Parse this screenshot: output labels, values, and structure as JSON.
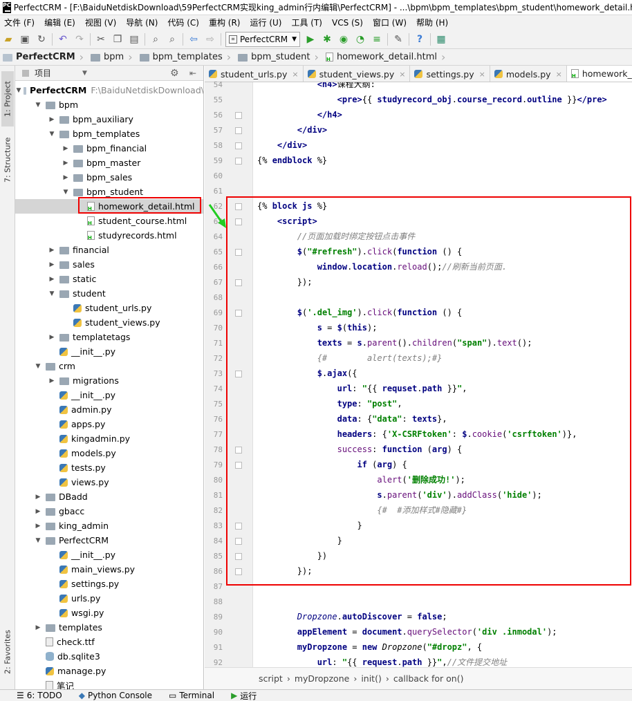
{
  "window": {
    "title": "PerfectCRM - [F:\\BaiduNetdiskDownload\\59PerfectCRM实现king_admin行内编辑\\PerfectCRM] - ...\\bpm\\bpm_templates\\bpm_student\\homework_detail.html"
  },
  "menu": [
    "文件 (F)",
    "编辑 (E)",
    "视图 (V)",
    "导航 (N)",
    "代码 (C)",
    "重构 (R)",
    "运行 (U)",
    "工具 (T)",
    "VCS (S)",
    "窗口 (W)",
    "帮助 (H)"
  ],
  "toolbar": {
    "run_config": "PerfectCRM"
  },
  "breadcrumbs": [
    "PerfectCRM",
    "bpm",
    "bpm_templates",
    "bpm_student",
    "homework_detail.html"
  ],
  "left_tabs": {
    "project": "1: Project",
    "structure": "7: Structure",
    "favorites": "2: Favorites"
  },
  "project_panel": {
    "title": "项目",
    "root_path": "F:\\BaiduNetdiskDownload\\"
  },
  "tree": [
    {
      "label": "PerfectCRM",
      "indent": 0,
      "arrow": "▼",
      "type": "folder"
    },
    {
      "label": "bpm",
      "indent": 1,
      "arrow": "▼",
      "type": "folder"
    },
    {
      "label": "bpm_auxiliary",
      "indent": 2,
      "arrow": "▶",
      "type": "folder"
    },
    {
      "label": "bpm_templates",
      "indent": 2,
      "arrow": "▼",
      "type": "folder"
    },
    {
      "label": "bpm_financial",
      "indent": 3,
      "arrow": "▶",
      "type": "folder"
    },
    {
      "label": "bpm_master",
      "indent": 3,
      "arrow": "▶",
      "type": "folder"
    },
    {
      "label": "bpm_sales",
      "indent": 3,
      "arrow": "▶",
      "type": "folder"
    },
    {
      "label": "bpm_student",
      "indent": 3,
      "arrow": "▼",
      "type": "folder"
    },
    {
      "label": "homework_detail.html",
      "indent": 4,
      "arrow": "",
      "type": "html",
      "selected": true
    },
    {
      "label": "student_course.html",
      "indent": 4,
      "arrow": "",
      "type": "html"
    },
    {
      "label": "studyrecords.html",
      "indent": 4,
      "arrow": "",
      "type": "html"
    },
    {
      "label": "financial",
      "indent": 2,
      "arrow": "▶",
      "type": "folder"
    },
    {
      "label": "sales",
      "indent": 2,
      "arrow": "▶",
      "type": "folder"
    },
    {
      "label": "static",
      "indent": 2,
      "arrow": "▶",
      "type": "folder"
    },
    {
      "label": "student",
      "indent": 2,
      "arrow": "▼",
      "type": "folder"
    },
    {
      "label": "student_urls.py",
      "indent": 3,
      "arrow": "",
      "type": "py"
    },
    {
      "label": "student_views.py",
      "indent": 3,
      "arrow": "",
      "type": "py"
    },
    {
      "label": "templatetags",
      "indent": 2,
      "arrow": "▶",
      "type": "folder"
    },
    {
      "label": "__init__.py",
      "indent": 2,
      "arrow": "",
      "type": "py"
    },
    {
      "label": "crm",
      "indent": 1,
      "arrow": "▼",
      "type": "folder"
    },
    {
      "label": "migrations",
      "indent": 2,
      "arrow": "▶",
      "type": "folder"
    },
    {
      "label": "__init__.py",
      "indent": 2,
      "arrow": "",
      "type": "py"
    },
    {
      "label": "admin.py",
      "indent": 2,
      "arrow": "",
      "type": "py"
    },
    {
      "label": "apps.py",
      "indent": 2,
      "arrow": "",
      "type": "py"
    },
    {
      "label": "kingadmin.py",
      "indent": 2,
      "arrow": "",
      "type": "py"
    },
    {
      "label": "models.py",
      "indent": 2,
      "arrow": "",
      "type": "py"
    },
    {
      "label": "tests.py",
      "indent": 2,
      "arrow": "",
      "type": "py"
    },
    {
      "label": "views.py",
      "indent": 2,
      "arrow": "",
      "type": "py"
    },
    {
      "label": "DBadd",
      "indent": 1,
      "arrow": "▶",
      "type": "folder"
    },
    {
      "label": "gbacc",
      "indent": 1,
      "arrow": "▶",
      "type": "folder"
    },
    {
      "label": "king_admin",
      "indent": 1,
      "arrow": "▶",
      "type": "folder"
    },
    {
      "label": "PerfectCRM",
      "indent": 1,
      "arrow": "▼",
      "type": "folder"
    },
    {
      "label": "__init__.py",
      "indent": 2,
      "arrow": "",
      "type": "py"
    },
    {
      "label": "main_views.py",
      "indent": 2,
      "arrow": "",
      "type": "py"
    },
    {
      "label": "settings.py",
      "indent": 2,
      "arrow": "",
      "type": "py"
    },
    {
      "label": "urls.py",
      "indent": 2,
      "arrow": "",
      "type": "py"
    },
    {
      "label": "wsgi.py",
      "indent": 2,
      "arrow": "",
      "type": "py"
    },
    {
      "label": "templates",
      "indent": 1,
      "arrow": "▶",
      "type": "folder"
    },
    {
      "label": "check.ttf",
      "indent": 1,
      "arrow": "",
      "type": "ttf"
    },
    {
      "label": "db.sqlite3",
      "indent": 1,
      "arrow": "",
      "type": "db"
    },
    {
      "label": "manage.py",
      "indent": 1,
      "arrow": "",
      "type": "py"
    },
    {
      "label": "笔记",
      "indent": 1,
      "arrow": "",
      "type": "ttf"
    }
  ],
  "editor_tabs": [
    {
      "label": "student_urls.py",
      "active": false
    },
    {
      "label": "student_views.py",
      "active": false
    },
    {
      "label": "settings.py",
      "active": false
    },
    {
      "label": "models.py",
      "active": false
    },
    {
      "label": "homework_detail.html",
      "active": true
    }
  ],
  "code_lines": [
    {
      "n": "54",
      "html": "            <span class=\"tag\">&lt;h4&gt;</span>课程大纲:"
    },
    {
      "n": "55",
      "html": "                <span class=\"tag\">&lt;pre&gt;</span>{{ <span class=\"var\">studyrecord_obj</span>.<span class=\"var\">course_record</span>.<span class=\"var\">outline</span> }}<span class=\"tag\">&lt;/pre&gt;</span>"
    },
    {
      "n": "56",
      "html": "            <span class=\"tag\">&lt;/h4&gt;</span>"
    },
    {
      "n": "57",
      "html": "        <span class=\"tag\">&lt;/div&gt;</span>"
    },
    {
      "n": "58",
      "html": "    <span class=\"tag\">&lt;/div&gt;</span>"
    },
    {
      "n": "59",
      "html": "{% <span class=\"kw\">endblock</span> %}"
    },
    {
      "n": "60",
      "html": ""
    },
    {
      "n": "61",
      "html": ""
    },
    {
      "n": "62",
      "html": "{% <span class=\"kw\">block</span> <span class=\"kw\">js</span> %}"
    },
    {
      "n": "63",
      "html": "    <span class=\"tag\">&lt;script&gt;</span>"
    },
    {
      "n": "64",
      "html": "        <span class=\"cm\">//页面加载时绑定按钮点击事件</span>"
    },
    {
      "n": "65",
      "html": "        <span class=\"var\">$</span>(<span class=\"str\">\"#refresh\"</span>).<span class=\"fn\">click</span>(<span class=\"kw\">function</span> () {"
    },
    {
      "n": "66",
      "html": "            <span class=\"var\">window</span>.<span class=\"var\">location</span>.<span class=\"fn\">reload</span>();<span class=\"cm\">//刷新当前页面.</span>"
    },
    {
      "n": "67",
      "html": "        });"
    },
    {
      "n": "68",
      "html": ""
    },
    {
      "n": "69",
      "html": "        <span class=\"var\">$</span>(<span class=\"str\">'.del_img'</span>).<span class=\"fn\">click</span>(<span class=\"kw\">function</span> () {"
    },
    {
      "n": "70",
      "html": "            <span class=\"var\">s</span> = <span class=\"var\">$</span>(<span class=\"kw\">this</span>);"
    },
    {
      "n": "71",
      "html": "            <span class=\"var\">texts</span> = <span class=\"var\">s</span>.<span class=\"fn\">parent</span>().<span class=\"fn\">children</span>(<span class=\"str\">\"span\"</span>).<span class=\"fn\">text</span>();"
    },
    {
      "n": "72",
      "html": "            <span class=\"cm\">{#        alert(texts);#}</span>"
    },
    {
      "n": "73",
      "html": "            <span class=\"var\">$</span>.<span class=\"var\">ajax</span>({"
    },
    {
      "n": "74",
      "html": "                <span class=\"var\">url</span>: <span class=\"str\">\"</span>{{ <span class=\"var\">requset</span>.<span class=\"var\">path</span> }}<span class=\"str\">\"</span>,"
    },
    {
      "n": "75",
      "html": "                <span class=\"var\">type</span>: <span class=\"str\">\"post\"</span>,"
    },
    {
      "n": "76",
      "html": "                <span class=\"var\">data</span>: {<span class=\"str\">\"data\"</span>: <span class=\"var\">texts</span>},"
    },
    {
      "n": "77",
      "html": "                <span class=\"var\">headers</span>: {<span class=\"str\">'X-CSRFtoken'</span>: <span class=\"var\">$</span>.<span class=\"fn\">cookie</span>(<span class=\"str\">'csrftoken'</span>)},"
    },
    {
      "n": "78",
      "html": "                <span class=\"fn\">success</span>: <span class=\"kw\">function</span> (<span class=\"var\">arg</span>) {"
    },
    {
      "n": "79",
      "html": "                    <span class=\"kw\">if</span> (<span class=\"var\">arg</span>) {"
    },
    {
      "n": "80",
      "html": "                        <span class=\"fn\">alert</span>(<span class=\"str\">'删除成功!'</span>);"
    },
    {
      "n": "81",
      "html": "                        <span class=\"var\">s</span>.<span class=\"fn\">parent</span>(<span class=\"str\">'div'</span>).<span class=\"fn\">addClass</span>(<span class=\"str\">'hide'</span>);"
    },
    {
      "n": "82",
      "html": "                        <span class=\"cm\">{#  #添加样式#隐藏#}</span>"
    },
    {
      "n": "83",
      "html": "                    }"
    },
    {
      "n": "84",
      "html": "                }"
    },
    {
      "n": "85",
      "html": "            })"
    },
    {
      "n": "86",
      "html": "        });"
    },
    {
      "n": "87",
      "html": ""
    },
    {
      "n": "88",
      "html": ""
    },
    {
      "n": "89",
      "html": "        <span class=\"var\" style=\"font-weight:normal;font-style:italic\">Dropzone</span>.<span class=\"var\">autoDiscover</span> = <span class=\"kw\">false</span>;"
    },
    {
      "n": "90",
      "html": "        <span class=\"var\">appElement</span> = <span class=\"var\">document</span>.<span class=\"fn\">querySelector</span>(<span class=\"str\">'div .inmodal'</span>);"
    },
    {
      "n": "91",
      "html": "        <span class=\"var\">myDropzone</span> = <span class=\"kw\">new</span> <span style=\"font-style:italic\">Dropzone</span>(<span class=\"str\">\"#dropz\"</span>, {"
    },
    {
      "n": "92",
      "html": "            <span class=\"var\">url</span>: <span class=\"str\">\"</span>{{ <span class=\"var\">request</span>.<span class=\"var\">path</span> }}<span class=\"str\">\"</span>,<span class=\"cm\">//文件提交地址</span>"
    }
  ],
  "code_breadcrumb": [
    "script",
    "myDropzone",
    "init()",
    "callback for on()"
  ],
  "bottom_tools": [
    "6: TODO",
    "Python Console",
    "Terminal",
    "运行"
  ],
  "colors": {
    "highlight_box": "#e00000",
    "arrow": "#22cc22"
  }
}
